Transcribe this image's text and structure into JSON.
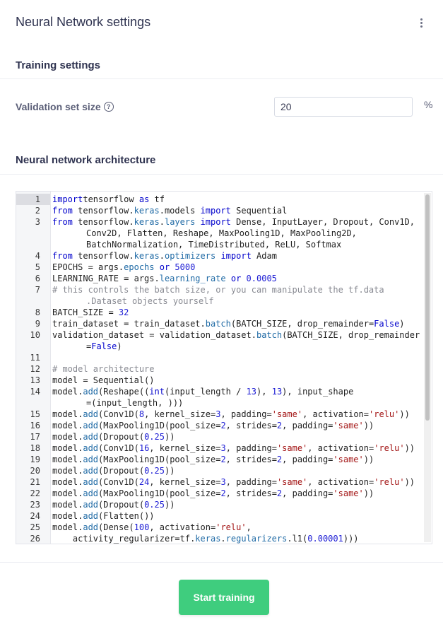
{
  "page": {
    "title": "Neural Network settings",
    "menu_icon": "kebab-menu-icon"
  },
  "training": {
    "title": "Training settings",
    "validation_label": "Validation set size",
    "validation_help_icon": "question-circle-icon",
    "validation_value": "20",
    "validation_unit": "%"
  },
  "architecture": {
    "title": "Neural network architecture",
    "editor": {
      "active_line": 1,
      "lines": [
        {
          "n": "1",
          "t": [
            [
              "kw",
              "import"
            ],
            [
              "",
              "tensorflow "
            ],
            [
              "kw",
              "as"
            ],
            [
              "",
              " tf"
            ]
          ]
        },
        {
          "n": "2",
          "t": [
            [
              "kw",
              "from"
            ],
            [
              "",
              " tensorflow."
            ],
            [
              "att",
              "keras"
            ],
            [
              "",
              ".models "
            ],
            [
              "kw",
              "import"
            ],
            [
              "",
              " Sequential"
            ]
          ]
        },
        {
          "n": "3",
          "t": [
            [
              "kw",
              "from"
            ],
            [
              "",
              " tensorflow."
            ],
            [
              "att",
              "keras"
            ],
            [
              "",
              "."
            ],
            [
              "att",
              "layers"
            ],
            [
              "kw",
              " import"
            ],
            [
              "",
              " Dense, InputLayer, Dropout, Conv1D,"
            ]
          ]
        },
        {
          "n": "",
          "t": [
            [
              "",
              "Conv2D, Flatten, Reshape, MaxPooling1D, MaxPooling2D,"
            ]
          ],
          "cont": true
        },
        {
          "n": "",
          "t": [
            [
              "",
              "BatchNormalization, TimeDistributed, ReLU, Softmax"
            ]
          ],
          "cont": true
        },
        {
          "n": "4",
          "t": [
            [
              "kw",
              "from"
            ],
            [
              "",
              " tensorflow."
            ],
            [
              "att",
              "keras"
            ],
            [
              "",
              "."
            ],
            [
              "att",
              "optimizers"
            ],
            [
              "kw",
              " import"
            ],
            [
              "",
              " Adam"
            ]
          ]
        },
        {
          "n": "5",
          "t": [
            [
              "",
              "EPOCHS = args."
            ],
            [
              "att",
              "epochs"
            ],
            [
              "kw",
              " or"
            ],
            [
              "num",
              " 5000"
            ]
          ]
        },
        {
          "n": "6",
          "t": [
            [
              "",
              "LEARNING_RATE = args."
            ],
            [
              "att",
              "learning_rate"
            ],
            [
              "kw",
              " or"
            ],
            [
              "num",
              " 0.0005"
            ]
          ]
        },
        {
          "n": "7",
          "t": [
            [
              "cm",
              "# this controls the batch size, or you can manipulate the tf.data"
            ]
          ]
        },
        {
          "n": "",
          "t": [
            [
              "cm",
              ".Dataset objects yourself"
            ]
          ],
          "cont": true
        },
        {
          "n": "8",
          "t": [
            [
              "",
              "BATCH_SIZE = "
            ],
            [
              "num",
              "32"
            ]
          ]
        },
        {
          "n": "9",
          "t": [
            [
              "",
              "train_dataset = train_dataset."
            ],
            [
              "att",
              "batch"
            ],
            [
              "",
              "(BATCH_SIZE, drop_remainder="
            ],
            [
              "kw",
              "False"
            ],
            [
              "",
              ")"
            ]
          ]
        },
        {
          "n": "10",
          "t": [
            [
              "",
              "validation_dataset = validation_dataset."
            ],
            [
              "att",
              "batch"
            ],
            [
              "",
              "(BATCH_SIZE, drop_remainder"
            ]
          ]
        },
        {
          "n": "",
          "t": [
            [
              "",
              "="
            ],
            [
              "kw",
              "False"
            ],
            [
              "",
              ")"
            ]
          ],
          "cont": true
        },
        {
          "n": "11",
          "t": [
            [
              "",
              ""
            ]
          ]
        },
        {
          "n": "12",
          "t": [
            [
              "cm",
              "# model architecture"
            ]
          ]
        },
        {
          "n": "13",
          "t": [
            [
              "",
              "model = Sequential()"
            ]
          ]
        },
        {
          "n": "14",
          "t": [
            [
              "",
              "model."
            ],
            [
              "att",
              "add"
            ],
            [
              "",
              "(Reshape(("
            ],
            [
              "kw",
              "int"
            ],
            [
              "",
              "(input_length / "
            ],
            [
              "num",
              "13"
            ],
            [
              "",
              "), "
            ],
            [
              "num",
              "13"
            ],
            [
              "",
              "), input_shape"
            ]
          ]
        },
        {
          "n": "",
          "t": [
            [
              "",
              "=(input_length, )))"
            ]
          ],
          "cont": true
        },
        {
          "n": "15",
          "t": [
            [
              "",
              "model."
            ],
            [
              "att",
              "add"
            ],
            [
              "",
              "(Conv1D("
            ],
            [
              "num",
              "8"
            ],
            [
              "",
              ", kernel_size="
            ],
            [
              "num",
              "3"
            ],
            [
              "",
              ", padding="
            ],
            [
              "str",
              "'same'"
            ],
            [
              "",
              ", activation="
            ],
            [
              "str",
              "'relu'"
            ],
            [
              "",
              "))"
            ]
          ]
        },
        {
          "n": "16",
          "t": [
            [
              "",
              "model."
            ],
            [
              "att",
              "add"
            ],
            [
              "",
              "(MaxPooling1D(pool_size="
            ],
            [
              "num",
              "2"
            ],
            [
              "",
              ", strides="
            ],
            [
              "num",
              "2"
            ],
            [
              "",
              ", padding="
            ],
            [
              "str",
              "'same'"
            ],
            [
              "",
              "))"
            ]
          ]
        },
        {
          "n": "17",
          "t": [
            [
              "",
              "model."
            ],
            [
              "att",
              "add"
            ],
            [
              "",
              "(Dropout("
            ],
            [
              "num",
              "0.25"
            ],
            [
              "",
              "))"
            ]
          ]
        },
        {
          "n": "18",
          "t": [
            [
              "",
              "model."
            ],
            [
              "att",
              "add"
            ],
            [
              "",
              "(Conv1D("
            ],
            [
              "num",
              "16"
            ],
            [
              "",
              ", kernel_size="
            ],
            [
              "num",
              "3"
            ],
            [
              "",
              ", padding="
            ],
            [
              "str",
              "'same'"
            ],
            [
              "",
              ", activation="
            ],
            [
              "str",
              "'relu'"
            ],
            [
              "",
              "))"
            ]
          ]
        },
        {
          "n": "19",
          "t": [
            [
              "",
              "model."
            ],
            [
              "att",
              "add"
            ],
            [
              "",
              "(MaxPooling1D(pool_size="
            ],
            [
              "num",
              "2"
            ],
            [
              "",
              ", strides="
            ],
            [
              "num",
              "2"
            ],
            [
              "",
              ", padding="
            ],
            [
              "str",
              "'same'"
            ],
            [
              "",
              "))"
            ]
          ]
        },
        {
          "n": "20",
          "t": [
            [
              "",
              "model."
            ],
            [
              "att",
              "add"
            ],
            [
              "",
              "(Dropout("
            ],
            [
              "num",
              "0.25"
            ],
            [
              "",
              "))"
            ]
          ]
        },
        {
          "n": "21",
          "t": [
            [
              "",
              "model."
            ],
            [
              "att",
              "add"
            ],
            [
              "",
              "(Conv1D("
            ],
            [
              "num",
              "24"
            ],
            [
              "",
              ", kernel_size="
            ],
            [
              "num",
              "3"
            ],
            [
              "",
              ", padding="
            ],
            [
              "str",
              "'same'"
            ],
            [
              "",
              ", activation="
            ],
            [
              "str",
              "'relu'"
            ],
            [
              "",
              "))"
            ]
          ]
        },
        {
          "n": "22",
          "t": [
            [
              "",
              "model."
            ],
            [
              "att",
              "add"
            ],
            [
              "",
              "(MaxPooling1D(pool_size="
            ],
            [
              "num",
              "2"
            ],
            [
              "",
              ", strides="
            ],
            [
              "num",
              "2"
            ],
            [
              "",
              ", padding="
            ],
            [
              "str",
              "'same'"
            ],
            [
              "",
              "))"
            ]
          ]
        },
        {
          "n": "23",
          "t": [
            [
              "",
              "model."
            ],
            [
              "att",
              "add"
            ],
            [
              "",
              "(Dropout("
            ],
            [
              "num",
              "0.25"
            ],
            [
              "",
              "))"
            ]
          ]
        },
        {
          "n": "24",
          "t": [
            [
              "",
              "model."
            ],
            [
              "att",
              "add"
            ],
            [
              "",
              "(Flatten())"
            ]
          ]
        },
        {
          "n": "25",
          "t": [
            [
              "",
              "model."
            ],
            [
              "att",
              "add"
            ],
            [
              "",
              "(Dense("
            ],
            [
              "num",
              "100"
            ],
            [
              "",
              ", activation="
            ],
            [
              "str",
              "'relu'"
            ],
            [
              "",
              ","
            ]
          ]
        },
        {
          "n": "26",
          "t": [
            [
              "",
              "    activity_regularizer=tf."
            ],
            [
              "att",
              "keras"
            ],
            [
              "",
              "."
            ],
            [
              "att",
              "regularizers"
            ],
            [
              "",
              ".l1("
            ],
            [
              "num",
              "0.00001"
            ],
            [
              "",
              ")))"
            ]
          ]
        }
      ]
    }
  },
  "actions": {
    "start_label": "Start training"
  },
  "colors": {
    "accent": "#3fcd7e",
    "keyword": "#0000cc",
    "comment": "#888a92",
    "string": "#a31515"
  }
}
